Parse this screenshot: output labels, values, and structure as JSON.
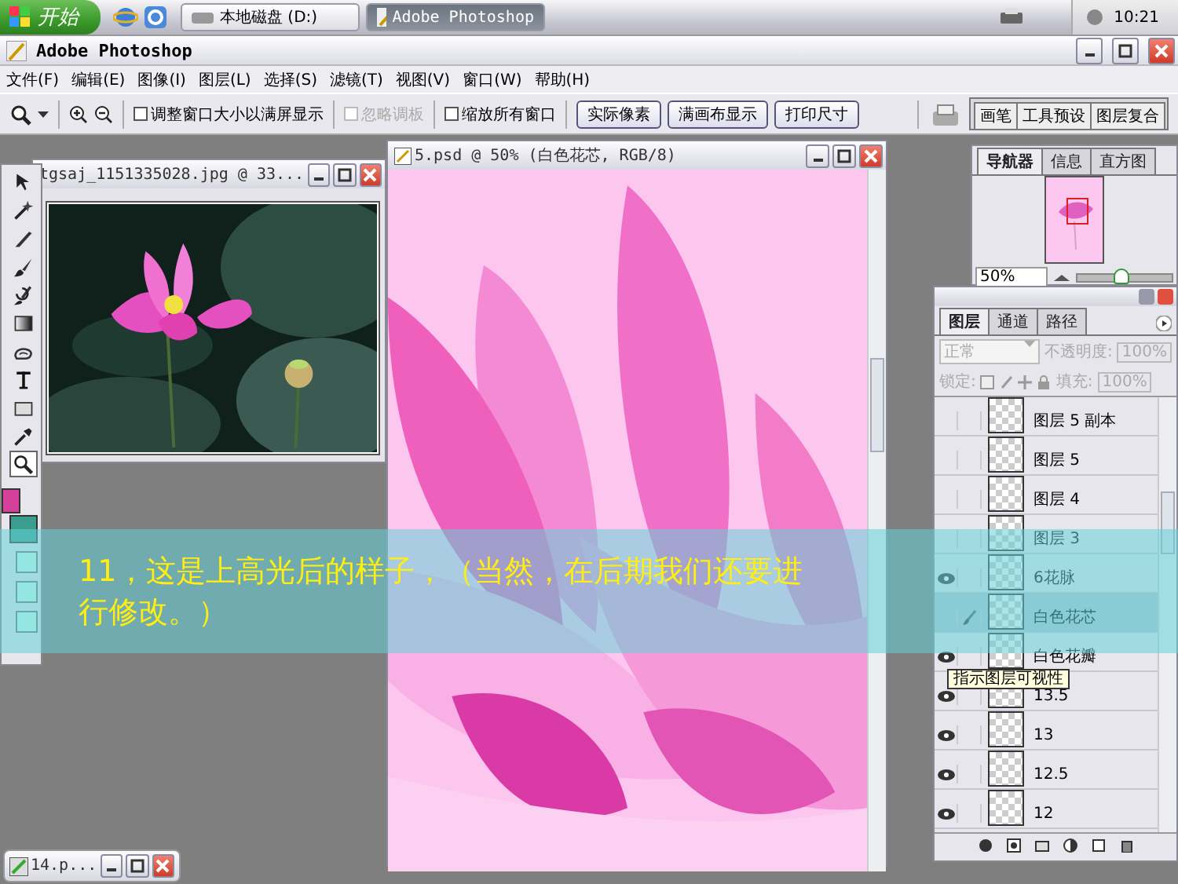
{
  "taskbar": {
    "start": "开始",
    "tasks": [
      {
        "label": "本地磁盘 (D:)",
        "selected": false
      },
      {
        "label": "Adobe Photoshop",
        "selected": true
      }
    ],
    "clock": "10:21"
  },
  "window": {
    "title": "Adobe Photoshop"
  },
  "menu": [
    "文件(F)",
    "编辑(E)",
    "图像(I)",
    "图层(L)",
    "选择(S)",
    "滤镜(T)",
    "视图(V)",
    "窗口(W)",
    "帮助(H)"
  ],
  "options": [
    {
      "kind": "checkbox",
      "label": "调整窗口大小以满屏显示",
      "checked": false,
      "disabled": false
    },
    {
      "kind": "checkbox",
      "label": "忽略调板",
      "checked": false,
      "disabled": true
    },
    {
      "kind": "checkbox",
      "label": "缩放所有窗口",
      "checked": false,
      "disabled": false
    },
    {
      "kind": "button",
      "label": "实际像素"
    },
    {
      "kind": "button",
      "label": "满画布显示"
    },
    {
      "kind": "button",
      "label": "打印尺寸"
    }
  ],
  "palette_well": [
    "画笔",
    "工具预设",
    "图层复合"
  ],
  "toolbox": [
    {
      "kind": "move",
      "selected": false
    },
    {
      "kind": "wand",
      "selected": false
    },
    {
      "kind": "knife",
      "selected": false
    },
    {
      "kind": "brush",
      "selected": false
    },
    {
      "kind": "history",
      "selected": false
    },
    {
      "kind": "gradient",
      "selected": false
    },
    {
      "kind": "smudge",
      "selected": false
    },
    {
      "kind": "type",
      "selected": false
    },
    {
      "kind": "shape",
      "selected": false
    },
    {
      "kind": "eyedropper",
      "selected": false
    },
    {
      "kind": "zoom",
      "selected": true
    }
  ],
  "photo_window": {
    "title": "tgsaj_1151335028.jpg @ 33..."
  },
  "document": {
    "title": "5.psd @ 50% (白色花芯, RGB/8)"
  },
  "navigator": {
    "tabs": [
      {
        "label": "导航器",
        "selected": true
      },
      {
        "label": "信息",
        "selected": false
      },
      {
        "label": "直方图",
        "selected": false
      }
    ],
    "zoom": "50%",
    "level": 0.45
  },
  "layers_panel": {
    "tabs": [
      {
        "label": "图层",
        "selected": true
      },
      {
        "label": "通道",
        "selected": false
      },
      {
        "label": "路径",
        "selected": false
      }
    ],
    "blend_mode": "正常",
    "opacity_label": "不透明度:",
    "opacity": "100%",
    "lock_label": "锁定:",
    "fill_label": "填充:",
    "fill": "100%",
    "layers": [
      {
        "name": "图层 5 副本",
        "visible": false,
        "selected": false
      },
      {
        "name": "图层 5",
        "visible": false,
        "selected": false
      },
      {
        "name": "图层 4",
        "visible": false,
        "selected": false
      },
      {
        "name": "图层 3",
        "visible": false,
        "selected": false
      },
      {
        "name": "6花脉",
        "visible": true,
        "selected": false
      },
      {
        "name": "白色花芯",
        "visible": false,
        "selected": true
      },
      {
        "name": "白色花瓣",
        "visible": true,
        "selected": false
      },
      {
        "name": "13.5",
        "visible": true,
        "selected": false
      },
      {
        "name": "13",
        "visible": true,
        "selected": false
      },
      {
        "name": "12.5",
        "visible": true,
        "selected": false
      },
      {
        "name": "12",
        "visible": true,
        "selected": false
      }
    ],
    "tooltip": "指示图层可视性"
  },
  "minimized": {
    "title": "14.p..."
  },
  "caption": "11，这是上高光后的样子，（当然，在后期我们还要进行修改。）"
}
